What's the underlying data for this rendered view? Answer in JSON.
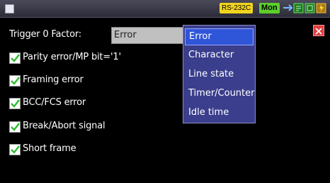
{
  "statusbar": {
    "interface": "RS-232C",
    "mode": "Mon",
    "icons": [
      "window-square-icon",
      "link-arrow-icon",
      "card-icon",
      "copy-icon",
      "power-icon"
    ]
  },
  "trigger": {
    "label": "Trigger 0 Factor:",
    "selected_value": "Error"
  },
  "dropdown": {
    "options": [
      "Error",
      "Character",
      "Line state",
      "Timer/Counter",
      "Idle time"
    ],
    "selected_index": 0
  },
  "checkboxes": [
    {
      "label": "Parity error/MP bit='1'",
      "checked": true
    },
    {
      "label": "Framing error",
      "checked": true
    },
    {
      "label": "BCC/FCS error",
      "checked": true
    },
    {
      "label": "Break/Abort signal",
      "checked": true
    },
    {
      "label": "Short frame",
      "checked": true
    }
  ],
  "colors": {
    "background": "#000000",
    "dropdown_bg": "#3a3e8c",
    "dropdown_selected": "#2f55d8",
    "check_green": "#2dbb2d",
    "close_red": "#e04040"
  }
}
